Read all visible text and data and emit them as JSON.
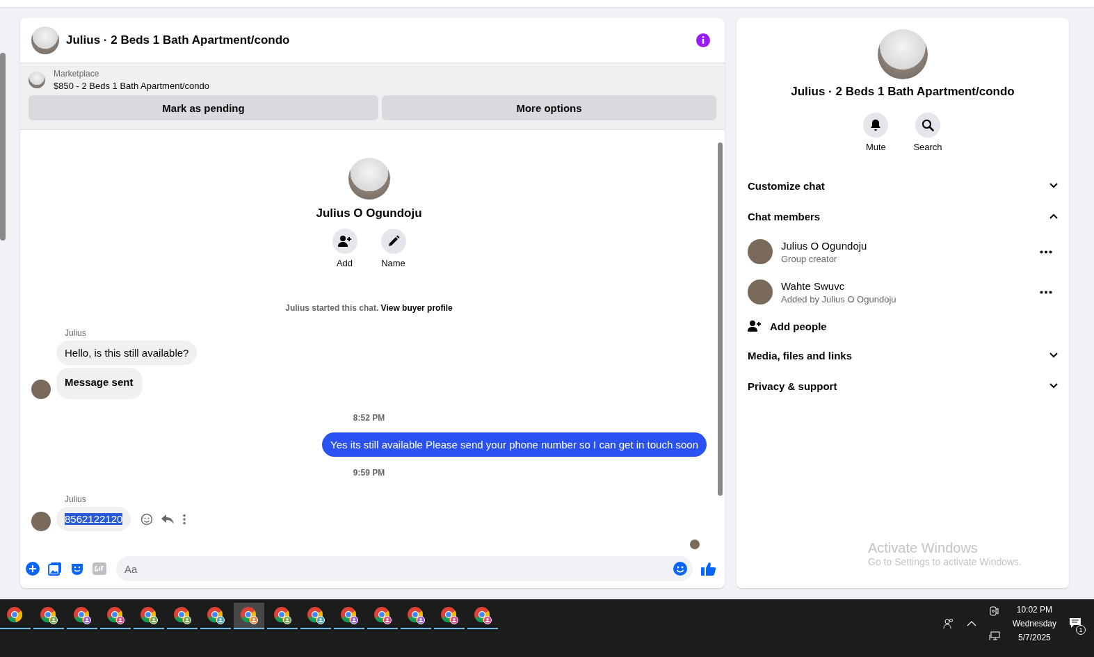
{
  "conversation": {
    "title": "Julius · 2 Beds 1 Bath Apartment/condo"
  },
  "listing": {
    "source": "Marketplace",
    "title": "$850 - 2 Beds 1 Bath Apartment/condo",
    "buttons": [
      "Mark as pending",
      "More options"
    ]
  },
  "chat_intro": {
    "name": "Julius O Ogundoju",
    "actions": [
      "Add",
      "Name"
    ]
  },
  "messages": [
    {
      "kind": "system",
      "text": "Julius started this chat.",
      "link": "View buyer profile"
    },
    {
      "kind": "sender",
      "text": "Julius"
    },
    {
      "kind": "incoming",
      "text": "Hello, is this still available?",
      "avatar": false,
      "bold": false,
      "text_selected": false
    },
    {
      "kind": "incoming",
      "text": "Message sent",
      "avatar": true,
      "bold": true,
      "text_selected": false
    },
    {
      "kind": "time",
      "text": "8:52 PM"
    },
    {
      "kind": "outgoing",
      "text": "Yes its still available Please send your phone number so I can get in touch soon"
    },
    {
      "kind": "time",
      "text": "9:59 PM"
    },
    {
      "kind": "sender",
      "text": "Julius"
    },
    {
      "kind": "incoming",
      "text": "8562122120",
      "avatar": true,
      "bold": false,
      "text_selected": true,
      "hover_actions": true
    }
  ],
  "composer": {
    "placeholder": "Aa"
  },
  "details": {
    "title": "Julius · 2 Beds 1 Bath Apartment/condo",
    "actions": [
      "Mute",
      "Search"
    ],
    "sections": [
      {
        "title": "Customize chat",
        "expanded": false
      },
      {
        "title": "Chat members",
        "expanded": true,
        "members": [
          {
            "name": "Julius O Ogundoju",
            "role": "Group creator"
          },
          {
            "name": "Wahte Swuvc",
            "role": "Added by Julius O Ogundoju"
          }
        ],
        "add_label": "Add people"
      },
      {
        "title": "Media, files and links",
        "expanded": false
      },
      {
        "title": "Privacy & support",
        "expanded": false
      }
    ]
  },
  "activation_notice": {
    "title": "Activate Windows",
    "text": "Go to Settings to activate Windows."
  },
  "taskbar": {
    "apps": [
      {
        "selected": false
      },
      {
        "selected": false,
        "color": "#6fa84a"
      },
      {
        "selected": false,
        "color": "#9a5ccf"
      },
      {
        "selected": false,
        "color": "#d8428c"
      },
      {
        "selected": false,
        "color": "#6fa84a"
      },
      {
        "selected": false,
        "color": "#6fa84a"
      },
      {
        "selected": false,
        "color": "#3fa3b5"
      },
      {
        "selected": true,
        "color": "#e8873a"
      },
      {
        "selected": false,
        "color": "#6fa84a"
      },
      {
        "selected": false,
        "color": "#3fa3b5"
      },
      {
        "selected": false,
        "color": "#9a5ccf"
      },
      {
        "selected": false,
        "color": "#d8428c"
      },
      {
        "selected": false,
        "color": "#9a5ccf"
      },
      {
        "selected": false,
        "color": "#d8428c"
      },
      {
        "selected": false,
        "color": "#d8428c"
      }
    ],
    "time": "10:02 PM",
    "day": "Wednesday",
    "date": "5/7/2025",
    "notifications": "1"
  }
}
